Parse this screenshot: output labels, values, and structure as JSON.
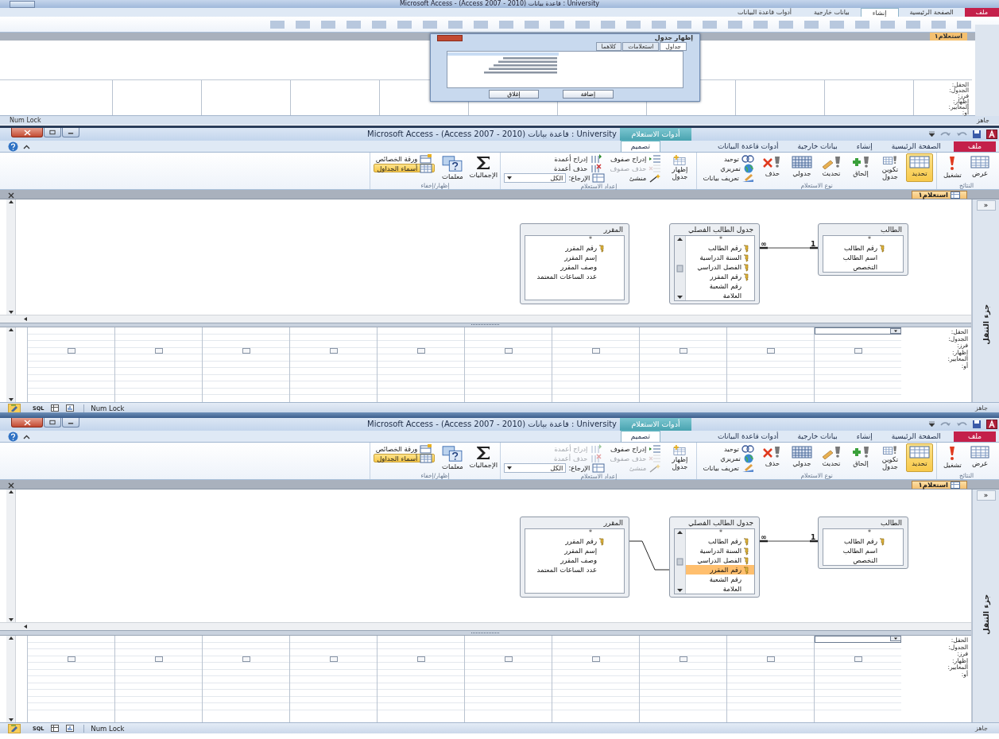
{
  "top_window": {
    "title": "Microsoft Access - (Access 2007 - 2010) قاعدة بيانات : University",
    "tabs": [
      {
        "label": "ملف",
        "selected": false
      },
      {
        "label": "الصفحة الرئيسية",
        "selected": false
      },
      {
        "label": "إنشاء",
        "selected": true
      },
      {
        "label": "بيانات خارجية",
        "selected": false
      },
      {
        "label": "أدوات قاعدة البيانات",
        "selected": false
      }
    ],
    "doc_tab": "استعلام١",
    "dialog": {
      "title": "إظهار جدول",
      "tabs": [
        {
          "label": "جداول",
          "selected": true
        },
        {
          "label": "استعلامات",
          "selected": false
        },
        {
          "label": "كلاهما",
          "selected": false
        }
      ],
      "buttons": [
        "إضافة",
        "إغلاق"
      ]
    },
    "grid_row_labels": [
      "الحقل:",
      "الجدول:",
      "فرز:",
      "إظهار:",
      "المعايير:",
      "أو:"
    ],
    "status_left": "Num Lock",
    "status_right": "جاهز"
  },
  "windows": [
    {
      "title": "Microsoft Access - (Access 2007 - 2010) قاعدة بيانات : University",
      "context_tab": "أدوات الاستعلام",
      "tabs": [
        {
          "label": "ملف",
          "selected": false
        },
        {
          "label": "الصفحة الرئيسية",
          "selected": false
        },
        {
          "label": "إنشاء",
          "selected": false
        },
        {
          "label": "بيانات خارجية",
          "selected": false
        },
        {
          "label": "أدوات قاعدة البيانات",
          "selected": false
        },
        {
          "label": "تصميم",
          "selected": true
        }
      ],
      "ribbon": [
        {
          "label": "النتائج",
          "buttons": [
            {
              "kind": "large",
              "label": "عرض",
              "selected": false,
              "disabled": false
            },
            {
              "kind": "large",
              "label": "تشغيل",
              "selected": false,
              "disabled": false
            }
          ]
        },
        {
          "label": "نوع الاستعلام",
          "buttons": [
            {
              "kind": "large",
              "label": "تحديد",
              "selected": true,
              "disabled": false
            },
            {
              "kind": "large",
              "label": "تكوين جدول",
              "selected": false,
              "disabled": false
            },
            {
              "kind": "large",
              "label": "إلحاق",
              "selected": false,
              "disabled": false
            },
            {
              "kind": "large",
              "label": "تحديث",
              "selected": false,
              "disabled": false
            },
            {
              "kind": "large",
              "label": "جدولي",
              "selected": false,
              "disabled": false
            },
            {
              "kind": "large",
              "label": "حذف",
              "selected": false,
              "disabled": false
            },
            {
              "kind": "small",
              "label": "توحيد",
              "selected": false,
              "disabled": false
            },
            {
              "kind": "small",
              "label": "تمريري",
              "selected": false,
              "disabled": false
            },
            {
              "kind": "small",
              "label": "تعريف بيانات",
              "selected": false,
              "disabled": false
            }
          ]
        },
        {
          "label": "إعداد الاستعلام",
          "buttons": [
            {
              "kind": "large",
              "label": "إظهار جدول",
              "selected": false,
              "disabled": false
            },
            {
              "kind": "small",
              "label": "إدراج صفوف",
              "selected": false,
              "disabled": false
            },
            {
              "kind": "small",
              "label": "حذف صفوف",
              "selected": false,
              "disabled": true
            },
            {
              "kind": "small",
              "label": "منشئ",
              "selected": false,
              "disabled": false
            },
            {
              "kind": "small",
              "label": "إدراج أعمدة",
              "selected": false,
              "disabled": false
            },
            {
              "kind": "small",
              "label": "حذف أعمدة",
              "selected": false,
              "disabled": false
            },
            {
              "kind": "dropdown",
              "label": "الإرجاع:",
              "value": "الكل"
            }
          ]
        },
        {
          "label": "إظهار/إخفاء",
          "buttons": [
            {
              "kind": "large",
              "label": "الإجماليات",
              "selected": false,
              "disabled": false
            },
            {
              "kind": "large",
              "label": "معلمات",
              "selected": false,
              "disabled": false
            },
            {
              "kind": "small",
              "label": "ورقة الخصائص",
              "selected": false,
              "disabled": false
            },
            {
              "kind": "small",
              "label": "أسماء الجداول",
              "selected": true,
              "disabled": false
            }
          ]
        }
      ],
      "doc_tab": "استعلام١",
      "nav_button": "»",
      "nav_pane": "جزء التنقل",
      "tables": [
        {
          "title": "الطالب",
          "star": "*",
          "fields": [
            {
              "name": "رقم الطالب",
              "key": true,
              "selected": false
            },
            {
              "name": "اسم الطالب",
              "key": false,
              "selected": false
            },
            {
              "name": "التخصص",
              "key": false,
              "selected": false
            }
          ]
        },
        {
          "title": "جدول الطالب الفصلي",
          "star": "*",
          "fields": [
            {
              "name": "رقم الطالب",
              "key": true,
              "selected": false
            },
            {
              "name": "السنة الدراسية",
              "key": true,
              "selected": false
            },
            {
              "name": "الفصل الدراسي",
              "key": true,
              "selected": false
            },
            {
              "name": "رقم المقرر",
              "key": true,
              "selected": false
            },
            {
              "name": "رقم الشعبة",
              "key": false,
              "selected": false
            },
            {
              "name": "العلامة",
              "key": false,
              "selected": false
            }
          ]
        },
        {
          "title": "المقرر",
          "star": "*",
          "fields": [
            {
              "name": "رقم المقرر",
              "key": true,
              "selected": false
            },
            {
              "name": "إسم المقرر",
              "key": false,
              "selected": false
            },
            {
              "name": "وصف المقرر",
              "key": false,
              "selected": false
            },
            {
              "name": "عدد الساعات المعتمد",
              "key": false,
              "selected": false
            }
          ]
        }
      ],
      "relationships": [
        {
          "kind": "one-to-many",
          "one_label": "1",
          "many_label": "∞"
        }
      ],
      "grid": {
        "row_labels": [
          "الحقل:",
          "الجدول:",
          "فرز:",
          "إظهار:",
          "المعايير:",
          "أو:"
        ],
        "columns": [
          {
            "active": true,
            "show": false
          },
          {
            "active": false,
            "show": false
          },
          {
            "active": false,
            "show": false
          },
          {
            "active": false,
            "show": false
          },
          {
            "active": false,
            "show": false
          },
          {
            "active": false,
            "show": false
          },
          {
            "active": false,
            "show": false
          },
          {
            "active": false,
            "show": false
          },
          {
            "active": false,
            "show": false
          },
          {
            "active": false,
            "show": false
          }
        ]
      },
      "status": {
        "views": [
          {
            "selected": true
          },
          {
            "selected": false
          },
          {
            "selected": false
          },
          {
            "selected": false
          }
        ],
        "sql": "SQL",
        "num_lock": "Num Lock",
        "ready": "جاهز"
      }
    },
    {
      "title": "Microsoft Access - (Access 2007 - 2010) قاعدة بيانات : University",
      "context_tab": "أدوات الاستعلام",
      "tabs": [
        {
          "label": "ملف",
          "selected": false
        },
        {
          "label": "الصفحة الرئيسية",
          "selected": false
        },
        {
          "label": "إنشاء",
          "selected": false
        },
        {
          "label": "بيانات خارجية",
          "selected": false
        },
        {
          "label": "أدوات قاعدة البيانات",
          "selected": false
        },
        {
          "label": "تصميم",
          "selected": true
        }
      ],
      "ribbon": [
        {
          "label": "النتائج",
          "buttons": [
            {
              "kind": "large",
              "label": "عرض",
              "selected": false,
              "disabled": false
            },
            {
              "kind": "large",
              "label": "تشغيل",
              "selected": false,
              "disabled": false
            }
          ]
        },
        {
          "label": "نوع الاستعلام",
          "buttons": [
            {
              "kind": "large",
              "label": "تحديد",
              "selected": true,
              "disabled": false
            },
            {
              "kind": "large",
              "label": "تكوين جدول",
              "selected": false,
              "disabled": false
            },
            {
              "kind": "large",
              "label": "إلحاق",
              "selected": false,
              "disabled": false
            },
            {
              "kind": "large",
              "label": "تحديث",
              "selected": false,
              "disabled": false
            },
            {
              "kind": "large",
              "label": "جدولي",
              "selected": false,
              "disabled": false
            },
            {
              "kind": "large",
              "label": "حذف",
              "selected": false,
              "disabled": false
            },
            {
              "kind": "small",
              "label": "توحيد",
              "selected": false,
              "disabled": false
            },
            {
              "kind": "small",
              "label": "تمريري",
              "selected": false,
              "disabled": false
            },
            {
              "kind": "small",
              "label": "تعريف بيانات",
              "selected": false,
              "disabled": false
            }
          ]
        },
        {
          "label": "إعداد الاستعلام",
          "buttons": [
            {
              "kind": "large",
              "label": "إظهار جدول",
              "selected": false,
              "disabled": false
            },
            {
              "kind": "small",
              "label": "إدراج صفوف",
              "selected": false,
              "disabled": false
            },
            {
              "kind": "small",
              "label": "حذف صفوف",
              "selected": false,
              "disabled": true
            },
            {
              "kind": "small",
              "label": "منشئ",
              "selected": false,
              "disabled": true
            },
            {
              "kind": "small",
              "label": "إدراج أعمدة",
              "selected": false,
              "disabled": true
            },
            {
              "kind": "small",
              "label": "حذف أعمدة",
              "selected": false,
              "disabled": true
            },
            {
              "kind": "dropdown",
              "label": "الإرجاع:",
              "value": "الكل"
            }
          ]
        },
        {
          "label": "إظهار/إخفاء",
          "buttons": [
            {
              "kind": "large",
              "label": "الإجماليات",
              "selected": false,
              "disabled": false
            },
            {
              "kind": "large",
              "label": "معلمات",
              "selected": false,
              "disabled": false
            },
            {
              "kind": "small",
              "label": "ورقة الخصائص",
              "selected": false,
              "disabled": false
            },
            {
              "kind": "small",
              "label": "أسماء الجداول",
              "selected": true,
              "disabled": false
            }
          ]
        }
      ],
      "doc_tab": "استعلام١",
      "nav_button": "»",
      "nav_pane": "جزء التنقل",
      "tables": [
        {
          "title": "الطالب",
          "star": "*",
          "fields": [
            {
              "name": "رقم الطالب",
              "key": true,
              "selected": false
            },
            {
              "name": "اسم الطالب",
              "key": false,
              "selected": false
            },
            {
              "name": "التخصص",
              "key": false,
              "selected": false
            }
          ]
        },
        {
          "title": "جدول الطالب الفصلي",
          "star": "*",
          "fields": [
            {
              "name": "رقم الطالب",
              "key": true,
              "selected": false
            },
            {
              "name": "السنة الدراسية",
              "key": true,
              "selected": false
            },
            {
              "name": "الفصل الدراسي",
              "key": true,
              "selected": false
            },
            {
              "name": "رقم المقرر",
              "key": true,
              "selected": true
            },
            {
              "name": "رقم الشعبة",
              "key": false,
              "selected": false
            },
            {
              "name": "العلامة",
              "key": false,
              "selected": false
            }
          ]
        },
        {
          "title": "المقرر",
          "star": "*",
          "fields": [
            {
              "name": "رقم المقرر",
              "key": true,
              "selected": false
            },
            {
              "name": "إسم المقرر",
              "key": false,
              "selected": false
            },
            {
              "name": "وصف المقرر",
              "key": false,
              "selected": false
            },
            {
              "name": "عدد الساعات المعتمد",
              "key": false,
              "selected": false
            }
          ]
        }
      ],
      "relationships": [
        {
          "kind": "one-to-many",
          "one_label": "1",
          "many_label": "∞"
        },
        {
          "kind": "plain"
        }
      ],
      "grid": {
        "row_labels": [
          "الحقل:",
          "الجدول:",
          "فرز:",
          "إظهار:",
          "المعايير:",
          "أو:"
        ],
        "columns": [
          {
            "active": true,
            "show": false
          },
          {
            "active": false,
            "show": false
          },
          {
            "active": false,
            "show": false
          },
          {
            "active": false,
            "show": false
          },
          {
            "active": false,
            "show": false
          },
          {
            "active": false,
            "show": false
          },
          {
            "active": false,
            "show": false
          },
          {
            "active": false,
            "show": false
          },
          {
            "active": false,
            "show": false
          },
          {
            "active": false,
            "show": false
          }
        ]
      },
      "status": {
        "views": [
          {
            "selected": true
          },
          {
            "selected": false
          },
          {
            "selected": false
          },
          {
            "selected": false
          }
        ],
        "sql": "SQL",
        "num_lock": "Num Lock",
        "ready": "جاهز"
      }
    }
  ]
}
